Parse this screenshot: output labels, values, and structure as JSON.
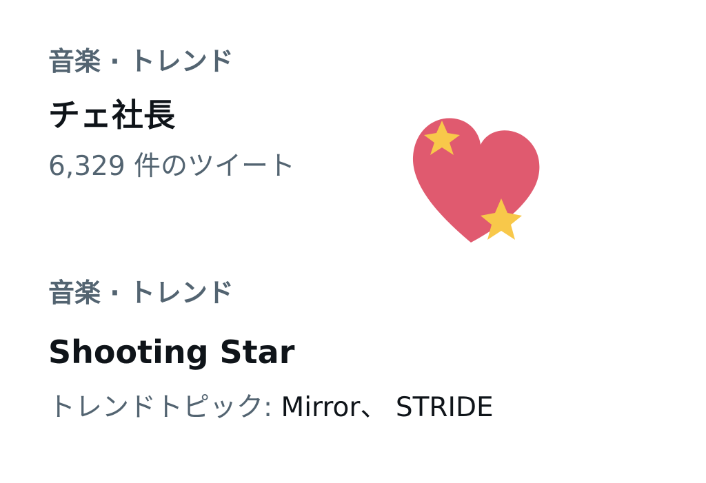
{
  "trends": [
    {
      "category": "音楽 · トレンド",
      "title": "チェ社長",
      "meta": "6,329 件のツイート"
    },
    {
      "category": "音楽 · トレンド",
      "title": "Shooting Star",
      "meta_prefix": "トレンドトピック: ",
      "meta_topics": "Mirror、 STRIDE"
    }
  ],
  "decoration": {
    "icon": "sparkling-heart-icon",
    "heart_color": "#e05a6f",
    "sparkle_color": "#f8c84a"
  }
}
